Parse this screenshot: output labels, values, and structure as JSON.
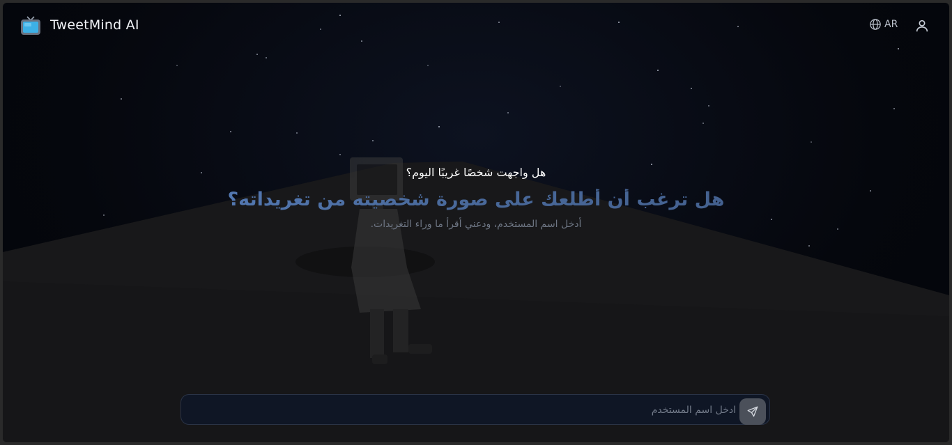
{
  "header": {
    "brand_name": "TweetMind AI",
    "language_label": "AR"
  },
  "hero": {
    "eyebrow": "هل واجهت شخصًا غريبًا اليوم؟",
    "headline": "هل ترغب أن أطلعك على صورة شخصيته من تغريداته؟",
    "subtitle": "أدخل اسم المستخدم، ودعني أقرأ ما وراء التغريدات."
  },
  "search": {
    "placeholder": "ادخل اسم المستخدم",
    "value": ""
  },
  "icons": {
    "logo": "retro-tv-icon",
    "language": "globe-icon",
    "user": "user-icon",
    "send": "send-icon"
  },
  "colors": {
    "background": "#05070d",
    "headline_gradient_start": "#5b86c8",
    "headline_gradient_end": "#3f5a86",
    "input_background": "#0f1625",
    "send_button": "#4b505a"
  }
}
